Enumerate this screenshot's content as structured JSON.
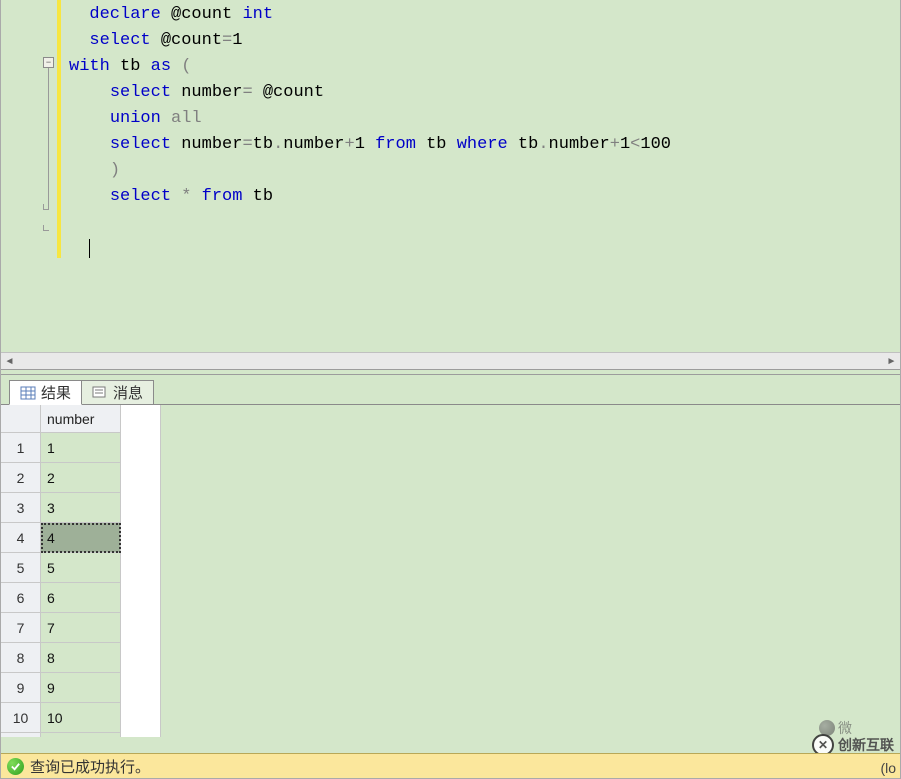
{
  "editor": {
    "code_lines": [
      {
        "indent": 0,
        "tokens": [
          [
            "kw",
            "declare"
          ],
          [
            "plain",
            " @count "
          ],
          [
            "kw",
            "int"
          ]
        ]
      },
      {
        "indent": 0,
        "tokens": [
          [
            "kw",
            "select"
          ],
          [
            "plain",
            " @count"
          ],
          [
            "op",
            "="
          ],
          [
            "num",
            "1"
          ]
        ]
      },
      {
        "indent": -1,
        "tokens": [
          [
            "kw",
            "with"
          ],
          [
            "plain",
            " tb "
          ],
          [
            "kw",
            "as"
          ],
          [
            "plain",
            " "
          ],
          [
            "op",
            "("
          ]
        ]
      },
      {
        "indent": 1,
        "tokens": [
          [
            "kw",
            "select"
          ],
          [
            "plain",
            " number"
          ],
          [
            "op",
            "="
          ],
          [
            "plain",
            " @count"
          ]
        ]
      },
      {
        "indent": 1,
        "tokens": [
          [
            "kw",
            "union"
          ],
          [
            "plain",
            " "
          ],
          [
            "gray",
            "all"
          ]
        ]
      },
      {
        "indent": 1,
        "tokens": [
          [
            "kw",
            "select"
          ],
          [
            "plain",
            " number"
          ],
          [
            "op",
            "="
          ],
          [
            "plain",
            "tb"
          ],
          [
            "op",
            "."
          ],
          [
            "plain",
            "number"
          ],
          [
            "op",
            "+"
          ],
          [
            "num",
            "1"
          ],
          [
            "plain",
            " "
          ],
          [
            "kw",
            "from"
          ],
          [
            "plain",
            " tb "
          ],
          [
            "kw",
            "where"
          ],
          [
            "plain",
            " tb"
          ],
          [
            "op",
            "."
          ],
          [
            "plain",
            "number"
          ],
          [
            "op",
            "+"
          ],
          [
            "num",
            "1"
          ],
          [
            "op",
            "<"
          ],
          [
            "num",
            "100"
          ]
        ]
      },
      {
        "indent": 1,
        "tokens": [
          [
            "op",
            ")"
          ]
        ]
      },
      {
        "indent": 1,
        "tokens": [
          [
            "kw",
            "select"
          ],
          [
            "plain",
            " "
          ],
          [
            "op",
            "*"
          ],
          [
            "plain",
            " "
          ],
          [
            "kw",
            "from"
          ],
          [
            "plain",
            " tb"
          ]
        ]
      }
    ]
  },
  "tabs": {
    "results": "结果",
    "messages": "消息"
  },
  "grid": {
    "column": "number",
    "rows": [
      {
        "n": "1",
        "v": "1"
      },
      {
        "n": "2",
        "v": "2"
      },
      {
        "n": "3",
        "v": "3"
      },
      {
        "n": "4",
        "v": "4"
      },
      {
        "n": "5",
        "v": "5"
      },
      {
        "n": "6",
        "v": "6"
      },
      {
        "n": "7",
        "v": "7"
      },
      {
        "n": "8",
        "v": "8"
      },
      {
        "n": "9",
        "v": "9"
      },
      {
        "n": "10",
        "v": "10"
      }
    ],
    "selected_idx": 3
  },
  "status": {
    "text": "查询已成功执行。",
    "right": "(lo"
  },
  "watermark": {
    "brand": "创新互联",
    "tip": "微"
  }
}
